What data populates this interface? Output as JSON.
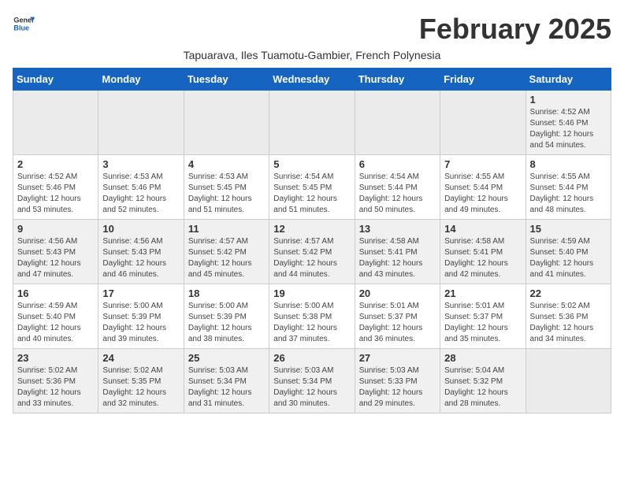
{
  "header": {
    "logo_general": "General",
    "logo_blue": "Blue",
    "month_title": "February 2025",
    "subtitle": "Tapuarava, Iles Tuamotu-Gambier, French Polynesia"
  },
  "weekdays": [
    "Sunday",
    "Monday",
    "Tuesday",
    "Wednesday",
    "Thursday",
    "Friday",
    "Saturday"
  ],
  "weeks": [
    [
      {
        "day": "",
        "sunrise": "",
        "sunset": "",
        "daylight": ""
      },
      {
        "day": "",
        "sunrise": "",
        "sunset": "",
        "daylight": ""
      },
      {
        "day": "",
        "sunrise": "",
        "sunset": "",
        "daylight": ""
      },
      {
        "day": "",
        "sunrise": "",
        "sunset": "",
        "daylight": ""
      },
      {
        "day": "",
        "sunrise": "",
        "sunset": "",
        "daylight": ""
      },
      {
        "day": "",
        "sunrise": "",
        "sunset": "",
        "daylight": ""
      },
      {
        "day": "1",
        "sunrise": "Sunrise: 4:52 AM",
        "sunset": "Sunset: 5:46 PM",
        "daylight": "Daylight: 12 hours and 54 minutes."
      }
    ],
    [
      {
        "day": "2",
        "sunrise": "Sunrise: 4:52 AM",
        "sunset": "Sunset: 5:46 PM",
        "daylight": "Daylight: 12 hours and 53 minutes."
      },
      {
        "day": "3",
        "sunrise": "Sunrise: 4:53 AM",
        "sunset": "Sunset: 5:46 PM",
        "daylight": "Daylight: 12 hours and 52 minutes."
      },
      {
        "day": "4",
        "sunrise": "Sunrise: 4:53 AM",
        "sunset": "Sunset: 5:45 PM",
        "daylight": "Daylight: 12 hours and 51 minutes."
      },
      {
        "day": "5",
        "sunrise": "Sunrise: 4:54 AM",
        "sunset": "Sunset: 5:45 PM",
        "daylight": "Daylight: 12 hours and 51 minutes."
      },
      {
        "day": "6",
        "sunrise": "Sunrise: 4:54 AM",
        "sunset": "Sunset: 5:44 PM",
        "daylight": "Daylight: 12 hours and 50 minutes."
      },
      {
        "day": "7",
        "sunrise": "Sunrise: 4:55 AM",
        "sunset": "Sunset: 5:44 PM",
        "daylight": "Daylight: 12 hours and 49 minutes."
      },
      {
        "day": "8",
        "sunrise": "Sunrise: 4:55 AM",
        "sunset": "Sunset: 5:44 PM",
        "daylight": "Daylight: 12 hours and 48 minutes."
      }
    ],
    [
      {
        "day": "9",
        "sunrise": "Sunrise: 4:56 AM",
        "sunset": "Sunset: 5:43 PM",
        "daylight": "Daylight: 12 hours and 47 minutes."
      },
      {
        "day": "10",
        "sunrise": "Sunrise: 4:56 AM",
        "sunset": "Sunset: 5:43 PM",
        "daylight": "Daylight: 12 hours and 46 minutes."
      },
      {
        "day": "11",
        "sunrise": "Sunrise: 4:57 AM",
        "sunset": "Sunset: 5:42 PM",
        "daylight": "Daylight: 12 hours and 45 minutes."
      },
      {
        "day": "12",
        "sunrise": "Sunrise: 4:57 AM",
        "sunset": "Sunset: 5:42 PM",
        "daylight": "Daylight: 12 hours and 44 minutes."
      },
      {
        "day": "13",
        "sunrise": "Sunrise: 4:58 AM",
        "sunset": "Sunset: 5:41 PM",
        "daylight": "Daylight: 12 hours and 43 minutes."
      },
      {
        "day": "14",
        "sunrise": "Sunrise: 4:58 AM",
        "sunset": "Sunset: 5:41 PM",
        "daylight": "Daylight: 12 hours and 42 minutes."
      },
      {
        "day": "15",
        "sunrise": "Sunrise: 4:59 AM",
        "sunset": "Sunset: 5:40 PM",
        "daylight": "Daylight: 12 hours and 41 minutes."
      }
    ],
    [
      {
        "day": "16",
        "sunrise": "Sunrise: 4:59 AM",
        "sunset": "Sunset: 5:40 PM",
        "daylight": "Daylight: 12 hours and 40 minutes."
      },
      {
        "day": "17",
        "sunrise": "Sunrise: 5:00 AM",
        "sunset": "Sunset: 5:39 PM",
        "daylight": "Daylight: 12 hours and 39 minutes."
      },
      {
        "day": "18",
        "sunrise": "Sunrise: 5:00 AM",
        "sunset": "Sunset: 5:39 PM",
        "daylight": "Daylight: 12 hours and 38 minutes."
      },
      {
        "day": "19",
        "sunrise": "Sunrise: 5:00 AM",
        "sunset": "Sunset: 5:38 PM",
        "daylight": "Daylight: 12 hours and 37 minutes."
      },
      {
        "day": "20",
        "sunrise": "Sunrise: 5:01 AM",
        "sunset": "Sunset: 5:37 PM",
        "daylight": "Daylight: 12 hours and 36 minutes."
      },
      {
        "day": "21",
        "sunrise": "Sunrise: 5:01 AM",
        "sunset": "Sunset: 5:37 PM",
        "daylight": "Daylight: 12 hours and 35 minutes."
      },
      {
        "day": "22",
        "sunrise": "Sunrise: 5:02 AM",
        "sunset": "Sunset: 5:36 PM",
        "daylight": "Daylight: 12 hours and 34 minutes."
      }
    ],
    [
      {
        "day": "23",
        "sunrise": "Sunrise: 5:02 AM",
        "sunset": "Sunset: 5:36 PM",
        "daylight": "Daylight: 12 hours and 33 minutes."
      },
      {
        "day": "24",
        "sunrise": "Sunrise: 5:02 AM",
        "sunset": "Sunset: 5:35 PM",
        "daylight": "Daylight: 12 hours and 32 minutes."
      },
      {
        "day": "25",
        "sunrise": "Sunrise: 5:03 AM",
        "sunset": "Sunset: 5:34 PM",
        "daylight": "Daylight: 12 hours and 31 minutes."
      },
      {
        "day": "26",
        "sunrise": "Sunrise: 5:03 AM",
        "sunset": "Sunset: 5:34 PM",
        "daylight": "Daylight: 12 hours and 30 minutes."
      },
      {
        "day": "27",
        "sunrise": "Sunrise: 5:03 AM",
        "sunset": "Sunset: 5:33 PM",
        "daylight": "Daylight: 12 hours and 29 minutes."
      },
      {
        "day": "28",
        "sunrise": "Sunrise: 5:04 AM",
        "sunset": "Sunset: 5:32 PM",
        "daylight": "Daylight: 12 hours and 28 minutes."
      },
      {
        "day": "",
        "sunrise": "",
        "sunset": "",
        "daylight": ""
      }
    ]
  ]
}
